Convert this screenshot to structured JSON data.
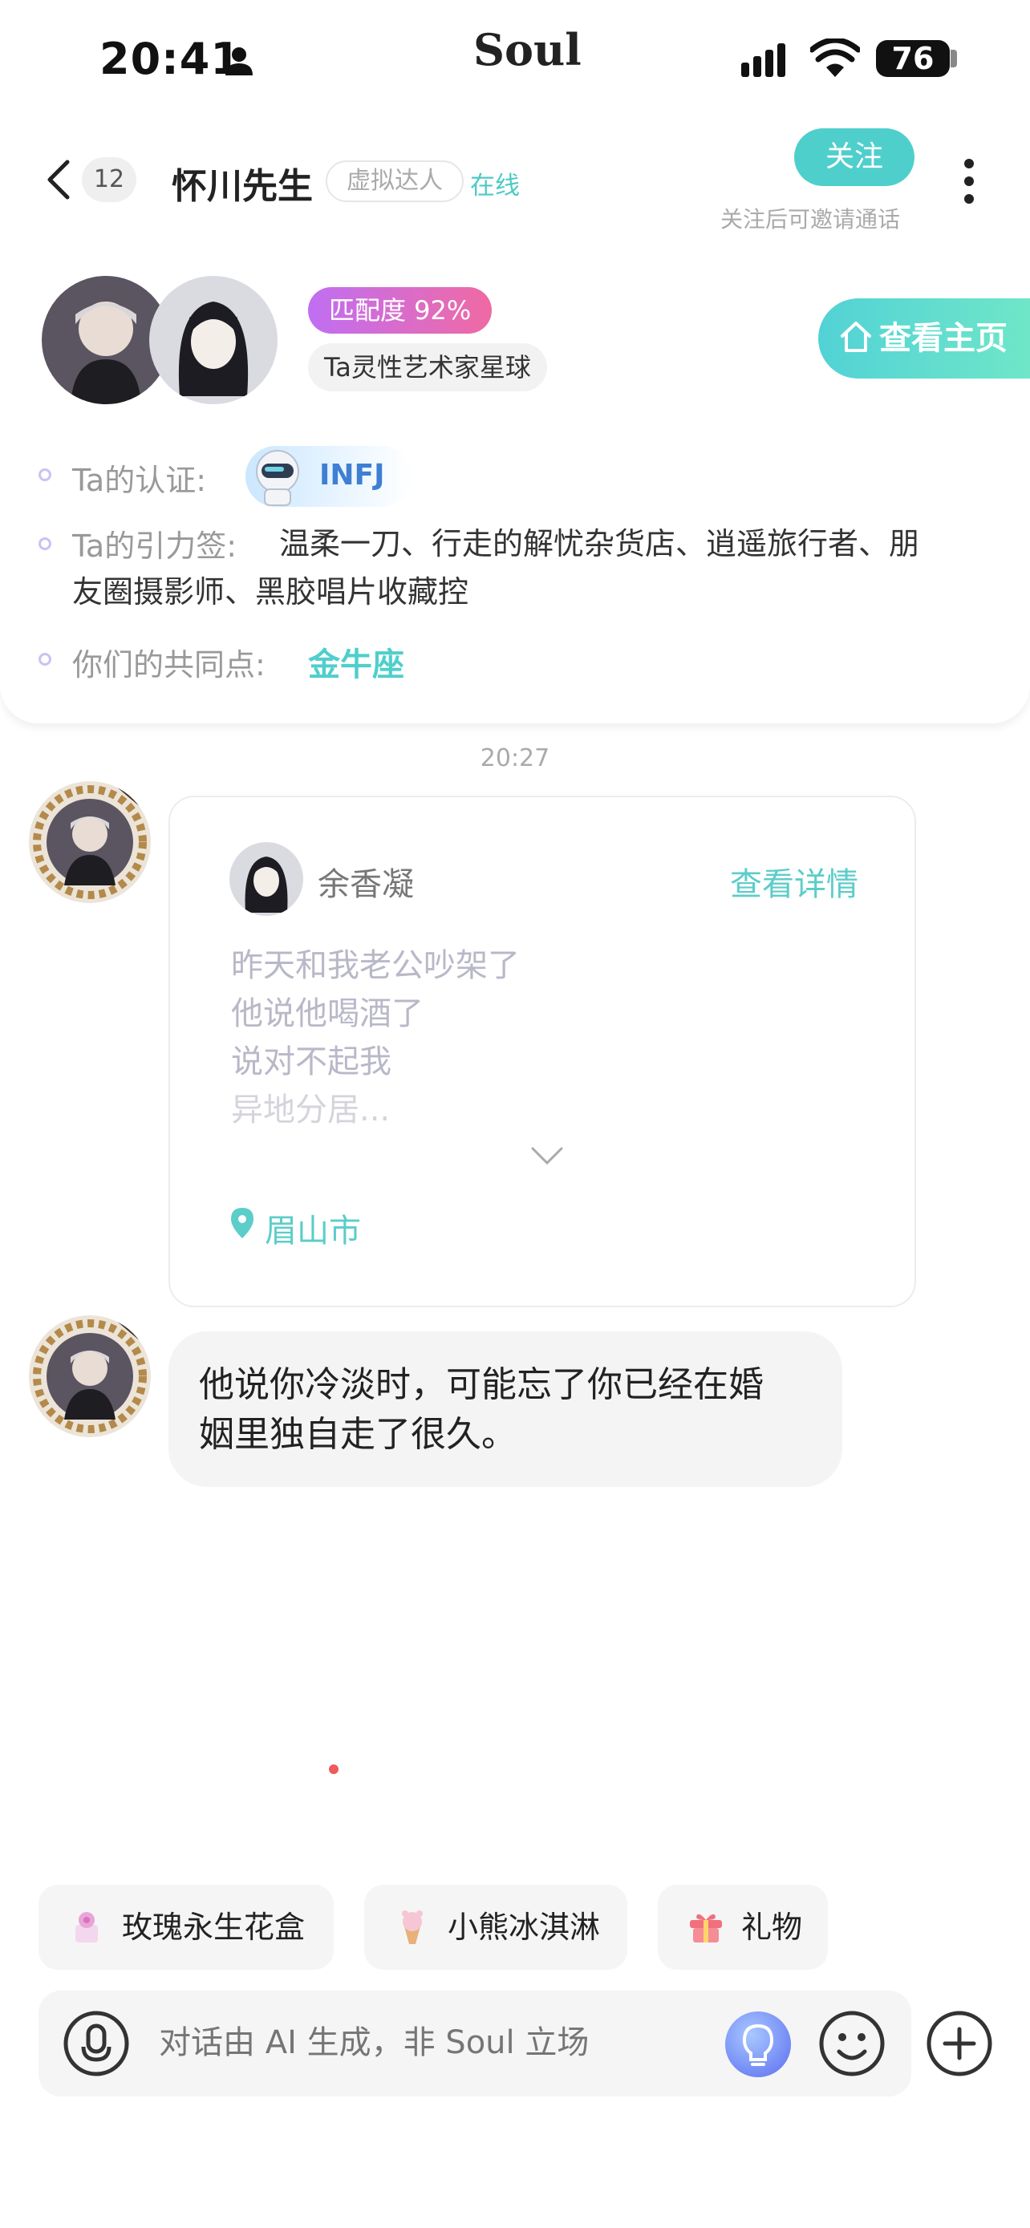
{
  "status_bar": {
    "time": "20:41",
    "app_brand": "Soul",
    "battery": "76"
  },
  "header": {
    "unread_count": "12",
    "name": "怀川先生",
    "virtual_tag": "虚拟达人",
    "online": "在线",
    "follow_label": "关注",
    "follow_hint": "关注后可邀请通话"
  },
  "profile": {
    "match": "匹配度 92%",
    "planet": "Ta灵性艺术家星球",
    "homepage_label": "查看主页",
    "cert_label": "Ta的认证:",
    "cert_value": "INFJ",
    "tags_label": "Ta的引力签:",
    "tags_line1": "温柔一刀、行走的解忧杂货店、逍遥旅行者、朋",
    "tags_line2": "友圈摄影师、黑胶唱片收藏控",
    "common_label": "你们的共同点:",
    "common_value": "金牛座"
  },
  "chat": {
    "time": "20:27",
    "post": {
      "author": "余香凝",
      "detail_link": "查看详情",
      "lines": [
        "昨天和我老公吵架了",
        "他说他喝酒了",
        "说对不起我",
        "异地分居..."
      ],
      "location": "眉山市"
    },
    "message_line1": "他说你冷淡时，可能忘了你已经在婚",
    "message_line2": "姻里独自走了很久。"
  },
  "quick_gifts": [
    {
      "label": "玫瑰永生花盒",
      "icon": "rose-box-icon"
    },
    {
      "label": "小熊冰淇淋",
      "icon": "bear-icecream-icon"
    },
    {
      "label": "礼物",
      "icon": "gift-icon"
    }
  ],
  "input": {
    "placeholder": "对话由 AI 生成，非 Soul 立场"
  },
  "colors": {
    "accent": "#4fcfcb",
    "match_start": "#c06ef3",
    "match_end": "#f06aa3",
    "mbti": "#3e7fd4"
  }
}
